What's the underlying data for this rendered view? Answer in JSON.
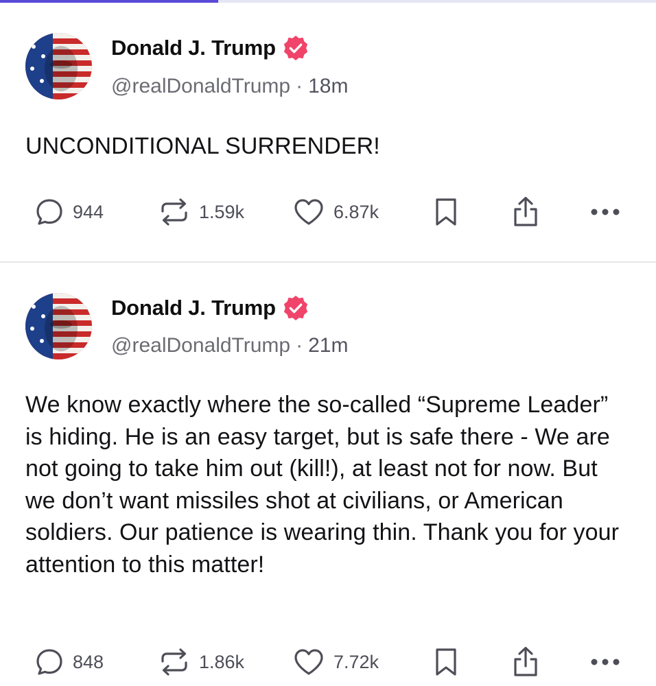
{
  "progress": {
    "fraction": 0.333,
    "fill_color": "#5a49d6",
    "track_color": "#e4e6f4"
  },
  "colors": {
    "verified": "#f0446b",
    "icon": "#4e4e58"
  },
  "icons": {
    "reply": "chat-bubble-icon",
    "repost": "repost-arrows-icon",
    "like": "heart-icon",
    "bookmark": "bookmark-icon",
    "share": "share-upload-icon",
    "more": "more-dots-icon"
  },
  "posts": [
    {
      "author": {
        "name": "Donald J. Trump",
        "handle": "@realDonaldTrump",
        "verified": true
      },
      "separator": "·",
      "time": "18m",
      "text": "UNCONDITIONAL SURRENDER!",
      "stats": {
        "replies": "944",
        "reposts": "1.59k",
        "likes": "6.87k"
      }
    },
    {
      "author": {
        "name": "Donald J. Trump",
        "handle": "@realDonaldTrump",
        "verified": true
      },
      "separator": "·",
      "time": "21m",
      "text": "We know exactly where the so-called “Supreme Leader” is hiding. He is an easy target, but is safe there - We are not going to take him out (kill!), at least not for now. But we don’t want missiles shot at civilians, or American soldiers. Our patience is wearing thin. Thank you for your attention to this matter!",
      "stats": {
        "replies": "848",
        "reposts": "1.86k",
        "likes": "7.72k"
      }
    }
  ]
}
